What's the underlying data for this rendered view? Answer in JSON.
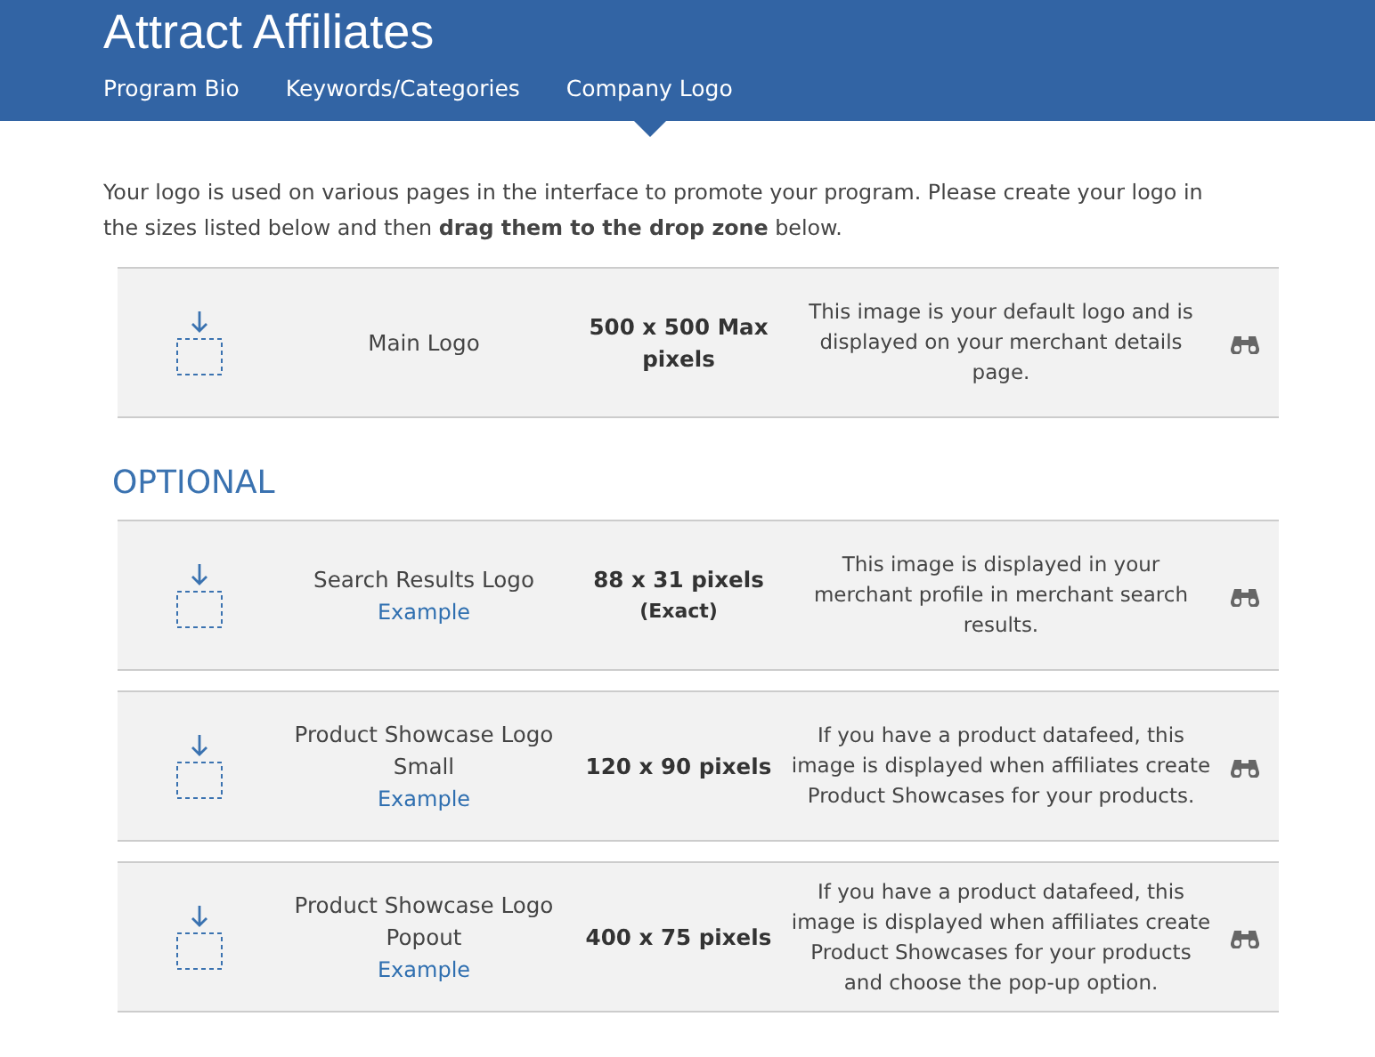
{
  "header": {
    "title": "Attract Affiliates",
    "tabs": [
      {
        "label": "Program Bio",
        "selected": false
      },
      {
        "label": "Keywords/Categories",
        "selected": false
      },
      {
        "label": "Company Logo",
        "selected": true
      }
    ]
  },
  "intro": "Your logo is used on various pages in the interface to promote your program. Please create your logo in the sizes listed below and then **drag them to the drop zone** below.",
  "main_logos": [
    {
      "name": "Main Logo",
      "size": "500 x 500 Max pixels",
      "description": "This image is your default logo and is displayed on your merchant details page."
    }
  ],
  "optional_heading": "OPTIONAL",
  "optional_logos": [
    {
      "name": "Search Results Logo",
      "link": "Example",
      "size": "88 x 31 pixels",
      "size_note": "(Exact)",
      "description": "This image is displayed in your merchant profile in merchant search results."
    },
    {
      "name": "Product Showcase Logo Small",
      "link": "Example",
      "size": "120 x 90 pixels",
      "description": "If you have a product datafeed, this image is displayed when affiliates create Product Showcases for your products."
    },
    {
      "name": "Product Showcase Logo Popout",
      "link": "Example",
      "size": "400 x 75 pixels",
      "description": "If you have a product datafeed, this image is displayed when affiliates create Product Showcases for your products and choose the pop-up option."
    }
  ]
}
